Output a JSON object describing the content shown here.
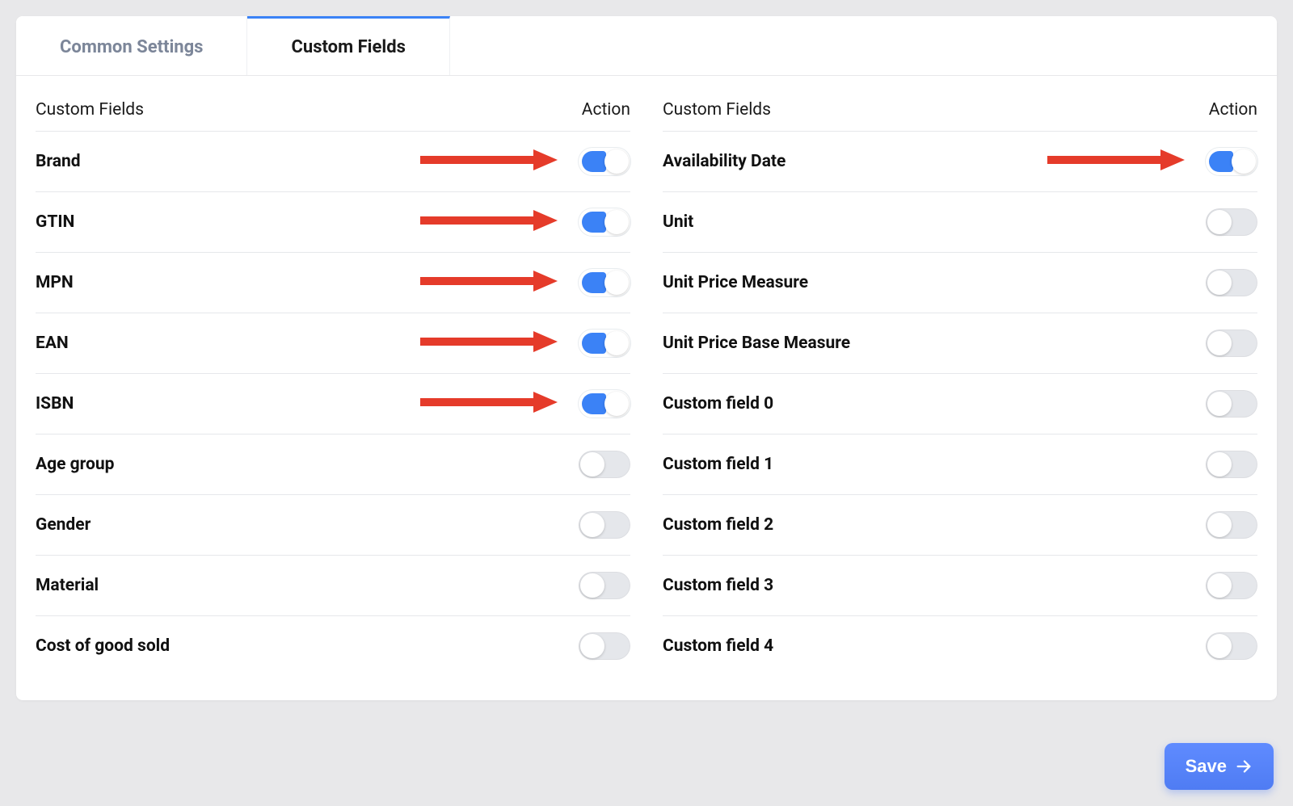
{
  "tabs": {
    "common": "Common Settings",
    "custom": "Custom Fields"
  },
  "headers": {
    "custom_fields": "Custom Fields",
    "action": "Action"
  },
  "left_fields": [
    {
      "label": "Brand",
      "on": true,
      "arrow": true
    },
    {
      "label": "GTIN",
      "on": true,
      "arrow": true
    },
    {
      "label": "MPN",
      "on": true,
      "arrow": true
    },
    {
      "label": "EAN",
      "on": true,
      "arrow": true
    },
    {
      "label": "ISBN",
      "on": true,
      "arrow": true
    },
    {
      "label": "Age group",
      "on": false,
      "arrow": false
    },
    {
      "label": "Gender",
      "on": false,
      "arrow": false
    },
    {
      "label": "Material",
      "on": false,
      "arrow": false
    },
    {
      "label": "Cost of good sold",
      "on": false,
      "arrow": false
    }
  ],
  "right_fields": [
    {
      "label": "Availability Date",
      "on": true,
      "arrow": true
    },
    {
      "label": "Unit",
      "on": false,
      "arrow": false
    },
    {
      "label": "Unit Price Measure",
      "on": false,
      "arrow": false
    },
    {
      "label": "Unit Price Base Measure",
      "on": false,
      "arrow": false
    },
    {
      "label": "Custom field 0",
      "on": false,
      "arrow": false
    },
    {
      "label": "Custom field 1",
      "on": false,
      "arrow": false
    },
    {
      "label": "Custom field 2",
      "on": false,
      "arrow": false
    },
    {
      "label": "Custom field 3",
      "on": false,
      "arrow": false
    },
    {
      "label": "Custom field 4",
      "on": false,
      "arrow": false
    }
  ],
  "buttons": {
    "save": "Save"
  },
  "colors": {
    "accent": "#3b82f6",
    "arrow": "#e53b2a"
  }
}
